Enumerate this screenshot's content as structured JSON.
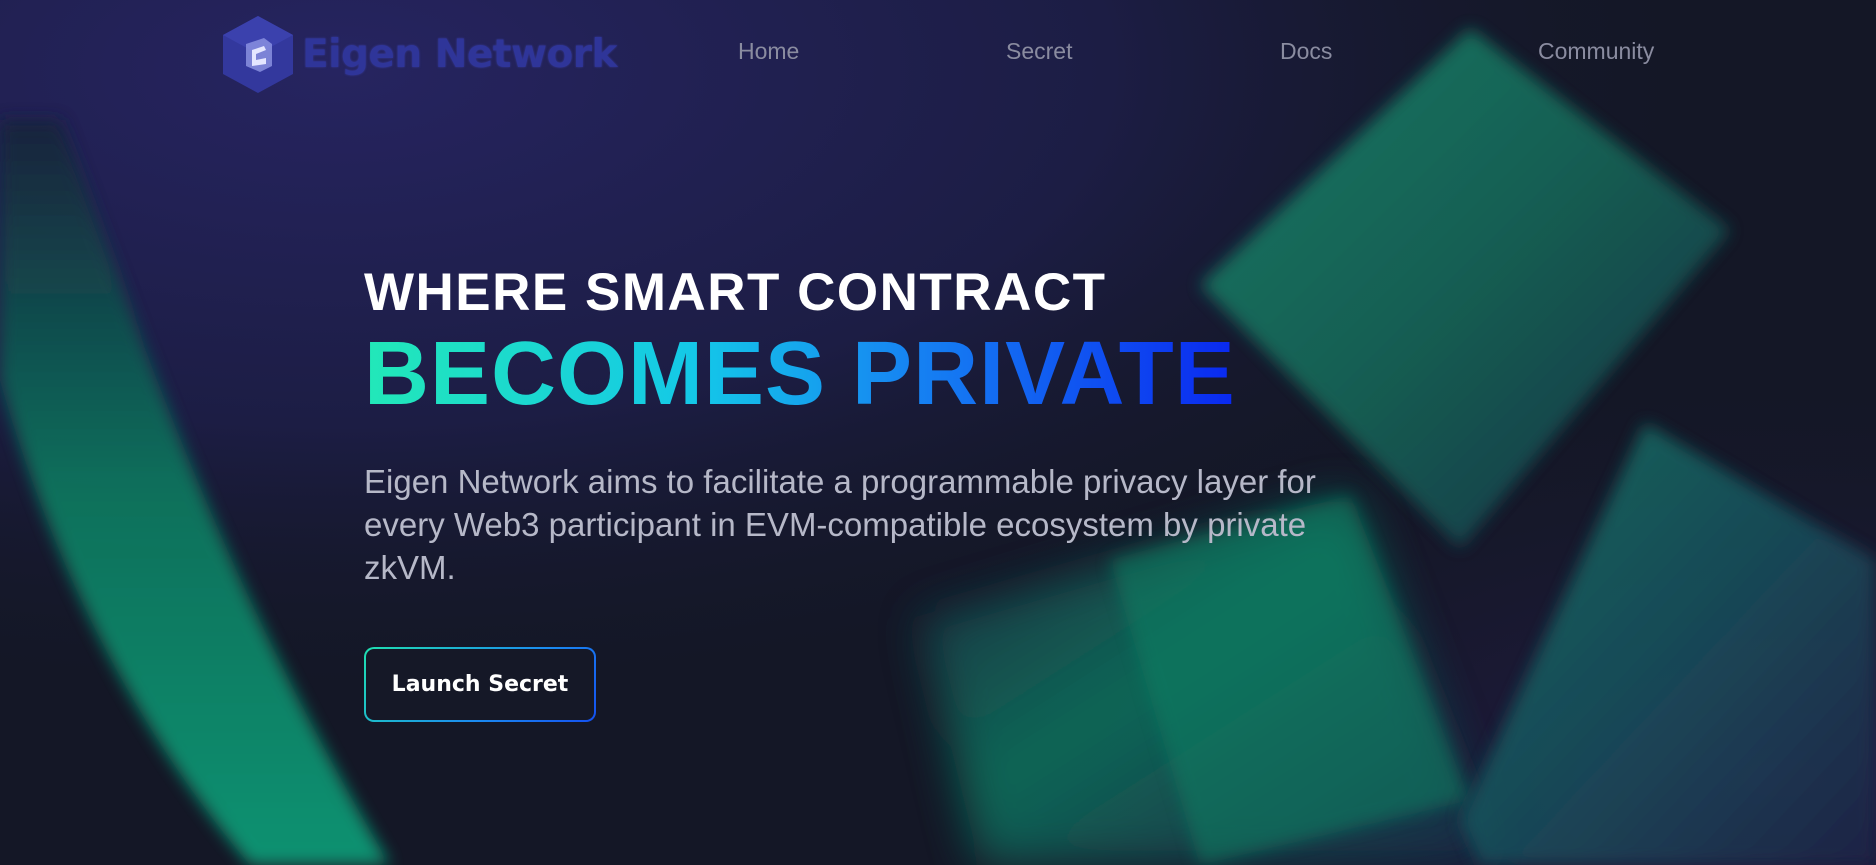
{
  "brand": {
    "name": "Eigen Network",
    "icon": "eigen-logo-icon"
  },
  "nav": {
    "items": [
      {
        "label": "Home"
      },
      {
        "label": "Secret"
      },
      {
        "label": "Docs"
      },
      {
        "label": "Community"
      }
    ]
  },
  "hero": {
    "headline_line1": "WHERE SMART CONTRACT",
    "headline_line2": "BECOMES PRIVATE",
    "description": "Eigen Network aims to facilitate a programmable privacy layer for every Web3 participant in EVM-compatible ecosystem by private zkVM.",
    "cta_label": "Launch Secret"
  },
  "colors": {
    "background": "#141726",
    "nav_text": "#8a8ca0",
    "logo": "#2f3599",
    "gradient_start": "#22e8b8",
    "gradient_end": "#0a28f0",
    "shape_green": "#0f9d78"
  }
}
